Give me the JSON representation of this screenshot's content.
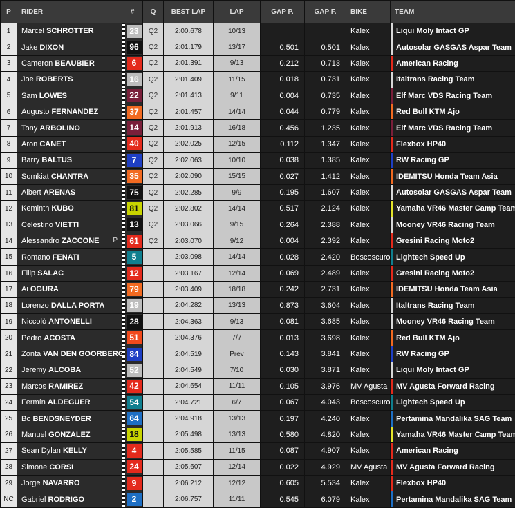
{
  "headers": {
    "pos": "P",
    "rider": "RIDER",
    "num": "#",
    "q": "Q",
    "best": "BEST LAP",
    "lap": "LAP",
    "gap_p": "GAP P.",
    "gap_f": "GAP F.",
    "bike": "BIKE",
    "team": "TEAM"
  },
  "rows": [
    {
      "pos": "1",
      "first": "Marcel",
      "last": "SCHROTTER",
      "mark": "",
      "num": "23",
      "numColor": "#bdbdbd",
      "q": "Q2",
      "best": "2:00.678",
      "lap": "10/13",
      "gap_p": "",
      "gap_f": "",
      "bike": "Kalex",
      "team": "Liqui Moly Intact GP",
      "teamColor": "#d8d8d8"
    },
    {
      "pos": "2",
      "first": "Jake",
      "last": "DIXON",
      "mark": "",
      "num": "96",
      "numColor": "#111111",
      "q": "Q2",
      "best": "2:01.179",
      "lap": "13/17",
      "gap_p": "0.501",
      "gap_f": "0.501",
      "bike": "Kalex",
      "team": "Autosolar GASGAS Aspar Team",
      "teamColor": "#d8d8d8"
    },
    {
      "pos": "3",
      "first": "Cameron",
      "last": "BEAUBIER",
      "mark": "",
      "num": "6",
      "numColor": "#e42a1c",
      "q": "Q2",
      "best": "2:01.391",
      "lap": "9/13",
      "gap_p": "0.212",
      "gap_f": "0.713",
      "bike": "Kalex",
      "team": "American Racing",
      "teamColor": "#e42a1c"
    },
    {
      "pos": "4",
      "first": "Joe",
      "last": "ROBERTS",
      "mark": "",
      "num": "16",
      "numColor": "#bdbdbd",
      "q": "Q2",
      "best": "2:01.409",
      "lap": "11/15",
      "gap_p": "0.018",
      "gap_f": "0.731",
      "bike": "Kalex",
      "team": "Italtrans Racing Team",
      "teamColor": "#d8d8d8"
    },
    {
      "pos": "5",
      "first": "Sam",
      "last": "LOWES",
      "mark": "",
      "num": "22",
      "numColor": "#7a1f3a",
      "q": "Q2",
      "best": "2:01.413",
      "lap": "9/11",
      "gap_p": "0.004",
      "gap_f": "0.735",
      "bike": "Kalex",
      "team": "Elf Marc VDS Racing Team",
      "teamColor": "#7a1f3a"
    },
    {
      "pos": "6",
      "first": "Augusto",
      "last": "FERNANDEZ",
      "mark": "",
      "num": "37",
      "numColor": "#f26a21",
      "q": "Q2",
      "best": "2:01.457",
      "lap": "14/14",
      "gap_p": "0.044",
      "gap_f": "0.779",
      "bike": "Kalex",
      "team": "Red Bull KTM Ajo",
      "teamColor": "#f26a21"
    },
    {
      "pos": "7",
      "first": "Tony",
      "last": "ARBOLINO",
      "mark": "",
      "num": "14",
      "numColor": "#7a1f3a",
      "q": "Q2",
      "best": "2:01.913",
      "lap": "16/18",
      "gap_p": "0.456",
      "gap_f": "1.235",
      "bike": "Kalex",
      "team": "Elf Marc VDS Racing Team",
      "teamColor": "#7a1f3a"
    },
    {
      "pos": "8",
      "first": "Aron",
      "last": "CANET",
      "mark": "",
      "num": "40",
      "numColor": "#e42a1c",
      "q": "Q2",
      "best": "2:02.025",
      "lap": "12/15",
      "gap_p": "0.112",
      "gap_f": "1.347",
      "bike": "Kalex",
      "team": "Flexbox HP40",
      "teamColor": "#e42a1c"
    },
    {
      "pos": "9",
      "first": "Barry",
      "last": "BALTUS",
      "mark": "",
      "num": "7",
      "numColor": "#1e3fc4",
      "q": "Q2",
      "best": "2:02.063",
      "lap": "10/10",
      "gap_p": "0.038",
      "gap_f": "1.385",
      "bike": "Kalex",
      "team": "RW Racing GP",
      "teamColor": "#1e3fc4"
    },
    {
      "pos": "10",
      "first": "Somkiat",
      "last": "CHANTRA",
      "mark": "",
      "num": "35",
      "numColor": "#f26a21",
      "q": "Q2",
      "best": "2:02.090",
      "lap": "15/15",
      "gap_p": "0.027",
      "gap_f": "1.412",
      "bike": "Kalex",
      "team": "IDEMITSU Honda Team Asia",
      "teamColor": "#f26a21"
    },
    {
      "pos": "11",
      "first": "Albert",
      "last": "ARENAS",
      "mark": "",
      "num": "75",
      "numColor": "#111111",
      "q": "Q2",
      "best": "2:02.285",
      "lap": "9/9",
      "gap_p": "0.195",
      "gap_f": "1.607",
      "bike": "Kalex",
      "team": "Autosolar GASGAS Aspar Team",
      "teamColor": "#d8d8d8"
    },
    {
      "pos": "12",
      "first": "Keminth",
      "last": "KUBO",
      "mark": "",
      "num": "81",
      "numColor": "#c8d400",
      "q": "Q2",
      "best": "2:02.802",
      "lap": "14/14",
      "gap_p": "0.517",
      "gap_f": "2.124",
      "bike": "Kalex",
      "team": "Yamaha VR46 Master Camp Team",
      "teamColor": "#e4e42a"
    },
    {
      "pos": "13",
      "first": "Celestino",
      "last": "VIETTI",
      "mark": "",
      "num": "13",
      "numColor": "#111111",
      "q": "Q2",
      "best": "2:03.066",
      "lap": "9/15",
      "gap_p": "0.264",
      "gap_f": "2.388",
      "bike": "Kalex",
      "team": "Mooney VR46 Racing Team",
      "teamColor": "#d8d8d8"
    },
    {
      "pos": "14",
      "first": "Alessandro",
      "last": "ZACCONE",
      "mark": "P",
      "num": "61",
      "numColor": "#e42a1c",
      "q": "Q2",
      "best": "2:03.070",
      "lap": "9/12",
      "gap_p": "0.004",
      "gap_f": "2.392",
      "bike": "Kalex",
      "team": "Gresini Racing Moto2",
      "teamColor": "#e42a1c"
    },
    {
      "pos": "15",
      "first": "Romano",
      "last": "FENATI",
      "mark": "",
      "num": "5",
      "numColor": "#0f7f8f",
      "q": "",
      "best": "2:03.098",
      "lap": "14/14",
      "gap_p": "0.028",
      "gap_f": "2.420",
      "bike": "Boscoscuro",
      "team": "Lightech Speed Up",
      "teamColor": "#0f7f8f"
    },
    {
      "pos": "16",
      "first": "Filip",
      "last": "SALAC",
      "mark": "",
      "num": "12",
      "numColor": "#e42a1c",
      "q": "",
      "best": "2:03.167",
      "lap": "12/14",
      "gap_p": "0.069",
      "gap_f": "2.489",
      "bike": "Kalex",
      "team": "Gresini Racing Moto2",
      "teamColor": "#e42a1c"
    },
    {
      "pos": "17",
      "first": "Ai",
      "last": "OGURA",
      "mark": "",
      "num": "79",
      "numColor": "#f26a21",
      "q": "",
      "best": "2:03.409",
      "lap": "18/18",
      "gap_p": "0.242",
      "gap_f": "2.731",
      "bike": "Kalex",
      "team": "IDEMITSU Honda Team Asia",
      "teamColor": "#f26a21"
    },
    {
      "pos": "18",
      "first": "Lorenzo",
      "last": "DALLA PORTA",
      "mark": "",
      "num": "19",
      "numColor": "#bdbdbd",
      "q": "",
      "best": "2:04.282",
      "lap": "13/13",
      "gap_p": "0.873",
      "gap_f": "3.604",
      "bike": "Kalex",
      "team": "Italtrans Racing Team",
      "teamColor": "#d8d8d8"
    },
    {
      "pos": "19",
      "first": "Niccolò",
      "last": "ANTONELLI",
      "mark": "",
      "num": "28",
      "numColor": "#111111",
      "q": "",
      "best": "2:04.363",
      "lap": "9/13",
      "gap_p": "0.081",
      "gap_f": "3.685",
      "bike": "Kalex",
      "team": "Mooney VR46 Racing Team",
      "teamColor": "#d8d8d8"
    },
    {
      "pos": "20",
      "first": "Pedro",
      "last": "ACOSTA",
      "mark": "",
      "num": "51",
      "numColor": "#f24a1c",
      "q": "",
      "best": "2:04.376",
      "lap": "7/7",
      "gap_p": "0.013",
      "gap_f": "3.698",
      "bike": "Kalex",
      "team": "Red Bull KTM Ajo",
      "teamColor": "#f26a21"
    },
    {
      "pos": "21",
      "first": "Zonta",
      "last": "VAN DEN GOORBERGH",
      "mark": "",
      "num": "84",
      "numColor": "#1e3fc4",
      "q": "",
      "best": "2:04.519",
      "lap": "Prev",
      "gap_p": "0.143",
      "gap_f": "3.841",
      "bike": "Kalex",
      "team": "RW Racing GP",
      "teamColor": "#1e3fc4"
    },
    {
      "pos": "22",
      "first": "Jeremy",
      "last": "ALCOBA",
      "mark": "",
      "num": "52",
      "numColor": "#bdbdbd",
      "q": "",
      "best": "2:04.549",
      "lap": "7/10",
      "gap_p": "0.030",
      "gap_f": "3.871",
      "bike": "Kalex",
      "team": "Liqui Moly Intact GP",
      "teamColor": "#d8d8d8"
    },
    {
      "pos": "23",
      "first": "Marcos",
      "last": "RAMIREZ",
      "mark": "",
      "num": "42",
      "numColor": "#e42a1c",
      "q": "",
      "best": "2:04.654",
      "lap": "11/11",
      "gap_p": "0.105",
      "gap_f": "3.976",
      "bike": "MV Agusta",
      "team": "MV Agusta Forward Racing",
      "teamColor": "#e42a1c"
    },
    {
      "pos": "24",
      "first": "Fermín",
      "last": "ALDEGUER",
      "mark": "",
      "num": "54",
      "numColor": "#0f7f8f",
      "q": "",
      "best": "2:04.721",
      "lap": "6/7",
      "gap_p": "0.067",
      "gap_f": "4.043",
      "bike": "Boscoscuro",
      "team": "Lightech Speed Up",
      "teamColor": "#0f7f8f"
    },
    {
      "pos": "25",
      "first": "Bo",
      "last": "BENDSNEYDER",
      "mark": "",
      "num": "64",
      "numColor": "#1e6fc4",
      "q": "",
      "best": "2:04.918",
      "lap": "13/13",
      "gap_p": "0.197",
      "gap_f": "4.240",
      "bike": "Kalex",
      "team": "Pertamina Mandalika SAG Team",
      "teamColor": "#1e6fc4"
    },
    {
      "pos": "26",
      "first": "Manuel",
      "last": "GONZALEZ",
      "mark": "",
      "num": "18",
      "numColor": "#c8d400",
      "q": "",
      "best": "2:05.498",
      "lap": "13/13",
      "gap_p": "0.580",
      "gap_f": "4.820",
      "bike": "Kalex",
      "team": "Yamaha VR46 Master Camp Team",
      "teamColor": "#e4e42a"
    },
    {
      "pos": "27",
      "first": "Sean Dylan",
      "last": "KELLY",
      "mark": "",
      "num": "4",
      "numColor": "#e42a1c",
      "q": "",
      "best": "2:05.585",
      "lap": "11/15",
      "gap_p": "0.087",
      "gap_f": "4.907",
      "bike": "Kalex",
      "team": "American Racing",
      "teamColor": "#e42a1c"
    },
    {
      "pos": "28",
      "first": "Simone",
      "last": "CORSI",
      "mark": "",
      "num": "24",
      "numColor": "#e42a1c",
      "q": "",
      "best": "2:05.607",
      "lap": "12/14",
      "gap_p": "0.022",
      "gap_f": "4.929",
      "bike": "MV Agusta",
      "team": "MV Agusta Forward Racing",
      "teamColor": "#e42a1c"
    },
    {
      "pos": "29",
      "first": "Jorge",
      "last": "NAVARRO",
      "mark": "",
      "num": "9",
      "numColor": "#e42a1c",
      "q": "",
      "best": "2:06.212",
      "lap": "12/12",
      "gap_p": "0.605",
      "gap_f": "5.534",
      "bike": "Kalex",
      "team": "Flexbox HP40",
      "teamColor": "#e42a1c"
    },
    {
      "pos": "NC",
      "first": "Gabriel",
      "last": "RODRIGO",
      "mark": "",
      "num": "2",
      "numColor": "#1e6fc4",
      "q": "",
      "best": "2:06.757",
      "lap": "11/11",
      "gap_p": "0.545",
      "gap_f": "6.079",
      "bike": "Kalex",
      "team": "Pertamina Mandalika SAG Team",
      "teamColor": "#1e6fc4"
    }
  ]
}
